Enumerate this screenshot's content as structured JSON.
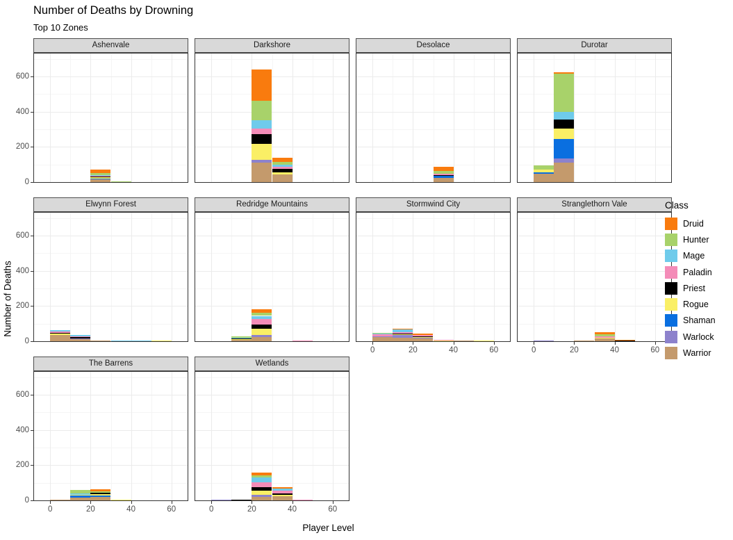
{
  "chart_data": {
    "type": "bar",
    "title": "Number of Deaths by Drowning",
    "subtitle": "Top 10 Zones",
    "xlabel": "Player Level",
    "ylabel": "Number of Deaths",
    "stacked": true,
    "facet_by": "zone",
    "legend_title": "Class",
    "legend_position": "right",
    "grid": true,
    "xlim": [
      -8,
      68
    ],
    "ylim": [
      0,
      730
    ],
    "x_ticks": [
      0,
      20,
      40,
      60
    ],
    "y_ticks": [
      0,
      200,
      400,
      600
    ],
    "x_minor_ticks": [
      10,
      30,
      50
    ],
    "y_minor_ticks": [
      100,
      300,
      500,
      700
    ],
    "bin_width": 10,
    "series": [
      {
        "name": "Druid",
        "color": "#f97b0e"
      },
      {
        "name": "Hunter",
        "color": "#a8d26a"
      },
      {
        "name": "Mage",
        "color": "#6fcbeb"
      },
      {
        "name": "Paladin",
        "color": "#f48cb8"
      },
      {
        "name": "Priest",
        "color": "#000000"
      },
      {
        "name": "Rogue",
        "color": "#faef65"
      },
      {
        "name": "Shaman",
        "color": "#0a6fe0"
      },
      {
        "name": "Warlock",
        "color": "#8d82cc"
      },
      {
        "name": "Warrior",
        "color": "#c49a6c"
      }
    ],
    "stack_order_bottom_to_top": [
      "Warrior",
      "Warlock",
      "Shaman",
      "Rogue",
      "Priest",
      "Paladin",
      "Mage",
      "Hunter",
      "Druid"
    ],
    "facets": [
      {
        "zone": "Ashenvale",
        "bins": [
          {
            "x0": 20,
            "x1": 30,
            "values": {
              "Warrior": 14,
              "Warlock": 0,
              "Shaman": 5,
              "Rogue": 8,
              "Priest": 6,
              "Paladin": 2,
              "Mage": 6,
              "Hunter": 10,
              "Druid": 20
            }
          },
          {
            "x0": 30,
            "x1": 40,
            "values": {
              "Warrior": 0,
              "Warlock": 0,
              "Shaman": 0,
              "Rogue": 0,
              "Priest": 0,
              "Paladin": 0,
              "Mage": 0,
              "Hunter": 5,
              "Druid": 0
            }
          }
        ]
      },
      {
        "zone": "Darkshore",
        "bins": [
          {
            "x0": 20,
            "x1": 30,
            "values": {
              "Warrior": 110,
              "Warlock": 18,
              "Shaman": 0,
              "Rogue": 90,
              "Priest": 55,
              "Paladin": 30,
              "Mage": 50,
              "Hunter": 110,
              "Druid": 175
            }
          },
          {
            "x0": 30,
            "x1": 40,
            "values": {
              "Warrior": 42,
              "Warlock": 0,
              "Shaman": 0,
              "Rogue": 12,
              "Priest": 20,
              "Paladin": 14,
              "Mage": 12,
              "Hunter": 16,
              "Druid": 24
            }
          }
        ]
      },
      {
        "zone": "Desolace",
        "bins": [
          {
            "x0": 30,
            "x1": 40,
            "values": {
              "Warrior": 22,
              "Warlock": 0,
              "Shaman": 14,
              "Rogue": 0,
              "Priest": 6,
              "Paladin": 4,
              "Mage": 0,
              "Hunter": 18,
              "Druid": 22
            }
          }
        ]
      },
      {
        "zone": "Durotar",
        "bins": [
          {
            "x0": 0,
            "x1": 10,
            "values": {
              "Warrior": 48,
              "Warlock": 0,
              "Shaman": 9,
              "Rogue": 14,
              "Priest": 0,
              "Paladin": 0,
              "Mage": 0,
              "Hunter": 22,
              "Druid": 0
            }
          },
          {
            "x0": 10,
            "x1": 20,
            "values": {
              "Warrior": 110,
              "Warlock": 26,
              "Shaman": 110,
              "Rogue": 58,
              "Priest": 50,
              "Paladin": 0,
              "Mage": 45,
              "Hunter": 215,
              "Druid": 8
            }
          }
        ]
      },
      {
        "zone": "Elwynn Forest",
        "bins": [
          {
            "x0": 0,
            "x1": 10,
            "values": {
              "Warrior": 34,
              "Warlock": 0,
              "Shaman": 0,
              "Rogue": 10,
              "Priest": 5,
              "Paladin": 7,
              "Mage": 6,
              "Hunter": 0,
              "Druid": 0
            }
          },
          {
            "x0": 10,
            "x1": 20,
            "values": {
              "Warrior": 12,
              "Warlock": 7,
              "Shaman": 0,
              "Rogue": 0,
              "Priest": 3,
              "Paladin": 6,
              "Mage": 8,
              "Hunter": 0,
              "Druid": 0
            }
          },
          {
            "x0": 20,
            "x1": 30,
            "values": {
              "Warrior": 4,
              "Warlock": 0,
              "Shaman": 0,
              "Rogue": 0,
              "Priest": 0,
              "Paladin": 0,
              "Mage": 0,
              "Hunter": 0,
              "Druid": 0
            }
          },
          {
            "x0": 30,
            "x1": 40,
            "values": {
              "Warrior": 0,
              "Warlock": 0,
              "Shaman": 0,
              "Rogue": 0,
              "Priest": 0,
              "Paladin": 0,
              "Mage": 4,
              "Hunter": 0,
              "Druid": 0
            }
          },
          {
            "x0": 40,
            "x1": 50,
            "values": {
              "Warrior": 0,
              "Warlock": 0,
              "Shaman": 0,
              "Rogue": 0,
              "Priest": 0,
              "Paladin": 0,
              "Mage": 4,
              "Hunter": 0,
              "Druid": 0
            }
          },
          {
            "x0": 50,
            "x1": 60,
            "values": {
              "Warrior": 0,
              "Warlock": 0,
              "Shaman": 0,
              "Rogue": 4,
              "Priest": 0,
              "Paladin": 0,
              "Mage": 0,
              "Hunter": 0,
              "Druid": 0
            }
          }
        ]
      },
      {
        "zone": "Redridge Mountains",
        "bins": [
          {
            "x0": 10,
            "x1": 20,
            "values": {
              "Warrior": 8,
              "Warlock": 0,
              "Shaman": 0,
              "Rogue": 6,
              "Priest": 3,
              "Paladin": 0,
              "Mage": 4,
              "Hunter": 5,
              "Druid": 0
            }
          },
          {
            "x0": 20,
            "x1": 30,
            "values": {
              "Warrior": 22,
              "Warlock": 12,
              "Shaman": 0,
              "Rogue": 38,
              "Priest": 24,
              "Paladin": 32,
              "Mage": 16,
              "Hunter": 16,
              "Druid": 22
            }
          },
          {
            "x0": 40,
            "x1": 50,
            "values": {
              "Warrior": 0,
              "Warlock": 0,
              "Shaman": 0,
              "Rogue": 0,
              "Priest": 0,
              "Paladin": 4,
              "Mage": 0,
              "Hunter": 0,
              "Druid": 0
            }
          }
        ]
      },
      {
        "zone": "Stormwind City",
        "bins": [
          {
            "x0": 0,
            "x1": 10,
            "values": {
              "Warrior": 22,
              "Warlock": 6,
              "Shaman": 0,
              "Rogue": 0,
              "Priest": 0,
              "Paladin": 12,
              "Mage": 5,
              "Hunter": 4,
              "Druid": 0
            }
          },
          {
            "x0": 10,
            "x1": 20,
            "values": {
              "Warrior": 20,
              "Warlock": 14,
              "Shaman": 0,
              "Rogue": 6,
              "Priest": 3,
              "Paladin": 10,
              "Mage": 14,
              "Hunter": 0,
              "Druid": 4
            }
          },
          {
            "x0": 20,
            "x1": 30,
            "values": {
              "Warrior": 14,
              "Warlock": 8,
              "Shaman": 0,
              "Rogue": 4,
              "Priest": 3,
              "Paladin": 6,
              "Mage": 5,
              "Hunter": 0,
              "Druid": 2
            }
          },
          {
            "x0": 30,
            "x1": 40,
            "values": {
              "Warrior": 3,
              "Warlock": 0,
              "Shaman": 0,
              "Rogue": 3,
              "Priest": 0,
              "Paladin": 3,
              "Mage": 0,
              "Hunter": 0,
              "Druid": 0
            }
          },
          {
            "x0": 40,
            "x1": 50,
            "values": {
              "Warrior": 4,
              "Warlock": 0,
              "Shaman": 0,
              "Rogue": 0,
              "Priest": 0,
              "Paladin": 0,
              "Mage": 0,
              "Hunter": 0,
              "Druid": 0
            }
          },
          {
            "x0": 50,
            "x1": 60,
            "values": {
              "Warrior": 0,
              "Warlock": 0,
              "Shaman": 0,
              "Rogue": 4,
              "Priest": 0,
              "Paladin": 0,
              "Mage": 0,
              "Hunter": 0,
              "Druid": 0
            }
          }
        ]
      },
      {
        "zone": "Stranglethorn Vale",
        "bins": [
          {
            "x0": 0,
            "x1": 10,
            "values": {
              "Warrior": 0,
              "Warlock": 4,
              "Shaman": 0,
              "Rogue": 0,
              "Priest": 0,
              "Paladin": 0,
              "Mage": 0,
              "Hunter": 0,
              "Druid": 0
            }
          },
          {
            "x0": 20,
            "x1": 30,
            "values": {
              "Warrior": 4,
              "Warlock": 0,
              "Shaman": 0,
              "Rogue": 0,
              "Priest": 0,
              "Paladin": 0,
              "Mage": 0,
              "Hunter": 0,
              "Druid": 0
            }
          },
          {
            "x0": 30,
            "x1": 40,
            "values": {
              "Warrior": 16,
              "Warlock": 0,
              "Shaman": 0,
              "Rogue": 4,
              "Priest": 0,
              "Paladin": 6,
              "Mage": 0,
              "Hunter": 12,
              "Druid": 12
            }
          },
          {
            "x0": 40,
            "x1": 50,
            "values": {
              "Warrior": 0,
              "Warlock": 0,
              "Shaman": 0,
              "Rogue": 0,
              "Priest": 5,
              "Paladin": 0,
              "Mage": 0,
              "Hunter": 0,
              "Druid": 4
            }
          }
        ]
      },
      {
        "zone": "The Barrens",
        "bins": [
          {
            "x0": 0,
            "x1": 10,
            "values": {
              "Warrior": 5,
              "Warlock": 0,
              "Shaman": 0,
              "Rogue": 0,
              "Priest": 0,
              "Paladin": 0,
              "Mage": 0,
              "Hunter": 0,
              "Druid": 0
            }
          },
          {
            "x0": 10,
            "x1": 20,
            "values": {
              "Warrior": 16,
              "Warlock": 0,
              "Shaman": 10,
              "Rogue": 6,
              "Priest": 0,
              "Paladin": 0,
              "Mage": 6,
              "Hunter": 22,
              "Druid": 0
            }
          },
          {
            "x0": 20,
            "x1": 30,
            "values": {
              "Warrior": 20,
              "Warlock": 0,
              "Shaman": 8,
              "Rogue": 6,
              "Priest": 10,
              "Paladin": 0,
              "Mage": 0,
              "Hunter": 6,
              "Druid": 15
            }
          },
          {
            "x0": 30,
            "x1": 40,
            "values": {
              "Warrior": 0,
              "Warlock": 0,
              "Shaman": 0,
              "Rogue": 4,
              "Priest": 0,
              "Paladin": 0,
              "Mage": 0,
              "Hunter": 0,
              "Druid": 0
            }
          }
        ]
      },
      {
        "zone": "Wetlands",
        "bins": [
          {
            "x0": 0,
            "x1": 10,
            "values": {
              "Warrior": 0,
              "Warlock": 4,
              "Shaman": 0,
              "Rogue": 0,
              "Priest": 0,
              "Paladin": 0,
              "Mage": 0,
              "Hunter": 0,
              "Druid": 0
            }
          },
          {
            "x0": 10,
            "x1": 20,
            "values": {
              "Warrior": 0,
              "Warlock": 0,
              "Shaman": 0,
              "Rogue": 0,
              "Priest": 5,
              "Paladin": 0,
              "Mage": 0,
              "Hunter": 0,
              "Druid": 0
            }
          },
          {
            "x0": 20,
            "x1": 30,
            "values": {
              "Warrior": 20,
              "Warlock": 12,
              "Shaman": 0,
              "Rogue": 22,
              "Priest": 20,
              "Paladin": 30,
              "Mage": 26,
              "Hunter": 12,
              "Druid": 14
            }
          },
          {
            "x0": 30,
            "x1": 40,
            "values": {
              "Warrior": 24,
              "Warlock": 0,
              "Shaman": 0,
              "Rogue": 10,
              "Priest": 4,
              "Paladin": 18,
              "Mage": 12,
              "Hunter": 0,
              "Druid": 8
            }
          },
          {
            "x0": 40,
            "x1": 50,
            "values": {
              "Warrior": 0,
              "Warlock": 0,
              "Shaman": 0,
              "Rogue": 0,
              "Priest": 0,
              "Paladin": 4,
              "Mage": 0,
              "Hunter": 0,
              "Druid": 0
            }
          }
        ]
      }
    ]
  }
}
